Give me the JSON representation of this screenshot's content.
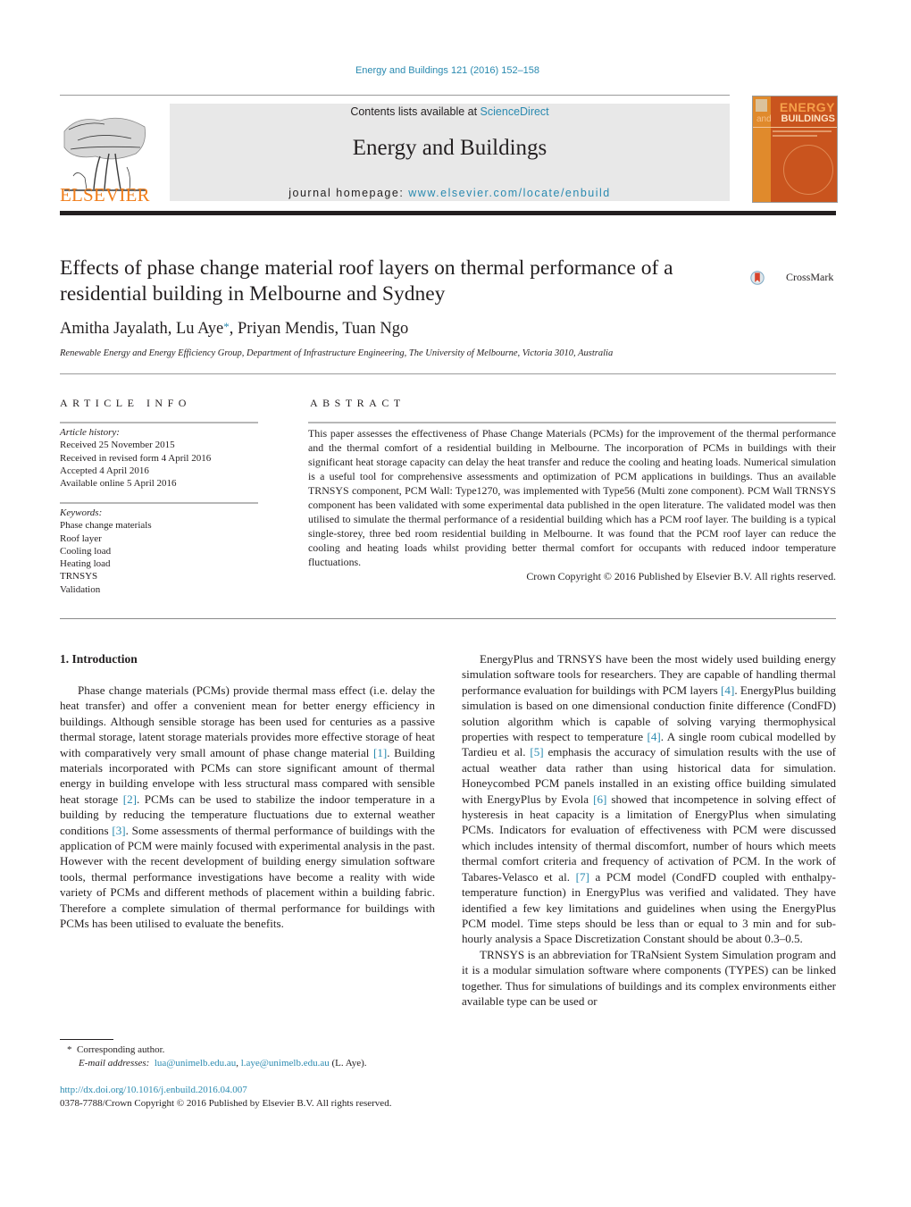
{
  "header": {
    "journal_ref": "Energy and Buildings 121 (2016) 152–158",
    "contents_prefix": "Contents lists available at ",
    "contents_link": "ScienceDirect",
    "journal_title": "Energy and Buildings",
    "homepage_prefix": "journal homepage: ",
    "homepage_link": "www.elsevier.com/locate/enbuild",
    "publisher_logo": "ELSEVIER",
    "cover": {
      "line1": "ENERGY",
      "line2_and": "and",
      "line2": "BUILDINGS"
    },
    "colors": {
      "link": "#2a8ab0",
      "elsevier_orange": "#f07d1a",
      "masthead_bg": "#e8e8e8"
    }
  },
  "article": {
    "title": "Effects of phase change material roof layers on thermal performance of a residential building in Melbourne and Sydney",
    "crossmark_label": "CrossMark",
    "authors_before": "Amitha Jayalath, Lu Aye",
    "authors_star": "*",
    "authors_after": ", Priyan Mendis, Tuan Ngo",
    "affiliation": "Renewable Energy and Energy Efficiency Group, Department of Infrastructure Engineering, The University of Melbourne, Victoria 3010, Australia"
  },
  "article_info": {
    "heading": "ARTICLE INFO",
    "history_label": "Article history:",
    "history": [
      "Received 25 November 2015",
      "Received in revised form 4 April 2016",
      "Accepted 4 April 2016",
      "Available online 5 April 2016"
    ],
    "keywords_label": "Keywords:",
    "keywords": [
      "Phase change materials",
      "Roof layer",
      "Cooling load",
      "Heating load",
      "TRNSYS",
      "Validation"
    ]
  },
  "abstract": {
    "heading": "ABSTRACT",
    "text": "This paper assesses the effectiveness of Phase Change Materials (PCMs) for the improvement of the thermal performance and the thermal comfort of a residential building in Melbourne. The incorporation of PCMs in buildings with their significant heat storage capacity can delay the heat transfer and reduce the cooling and heating loads. Numerical simulation is a useful tool for comprehensive assessments and optimization of PCM applications in buildings. Thus an available TRNSYS component, PCM Wall: Type1270, was implemented with Type56 (Multi zone component). PCM Wall TRNSYS component has been validated with some experimental data published in the open literature. The validated model was then utilised to simulate the thermal performance of a residential building which has a PCM roof layer. The building is a typical single-storey, three bed room residential building in Melbourne. It was found that the PCM roof layer can reduce the cooling and heating loads whilst providing better thermal comfort for occupants with reduced indoor temperature fluctuations.",
    "copyright": "Crown Copyright © 2016 Published by Elsevier B.V. All rights reserved."
  },
  "body": {
    "section_heading": "1.  Introduction",
    "left_para": [
      {
        "t": "Phase change materials (PCMs) provide thermal mass effect (i.e. delay the heat transfer) and offer a convenient mean for better energy efficiency in buildings. Although sensible storage has been used for centuries as a passive thermal storage, latent storage materials provides more effective storage of heat with comparatively very small amount of phase change material "
      },
      {
        "ref": "[1]"
      },
      {
        "t": ". Building materials incorporated with PCMs can store significant amount of thermal energy in building envelope with less structural mass compared with sensible heat storage "
      },
      {
        "ref": "[2]"
      },
      {
        "t": ". PCMs can be used to stabilize the indoor temperature in a building by reducing the temperature fluctuations due to external weather conditions "
      },
      {
        "ref": "[3]"
      },
      {
        "t": ". Some assessments of thermal performance of buildings with the application of PCM were mainly focused with experimental analysis in the past. However with the recent development of building energy simulation software tools, thermal performance investigations have become a reality with wide variety of PCMs and different methods of placement within a building fabric. Therefore a complete simulation of thermal performance for buildings with PCMs has been utilised to evaluate the benefits."
      }
    ],
    "right_para_1": [
      {
        "t": "EnergyPlus and TRNSYS have been the most widely used building energy simulation software tools for researchers. They are capable of handling thermal performance evaluation for buildings with PCM layers "
      },
      {
        "ref": "[4]"
      },
      {
        "t": ". EnergyPlus building simulation is based on one dimensional conduction finite difference (CondFD) solution algorithm which is capable of solving varying thermophysical properties with respect to temperature "
      },
      {
        "ref": "[4]"
      },
      {
        "t": ". A single room cubical modelled by Tardieu et al. "
      },
      {
        "ref": "[5]"
      },
      {
        "t": " emphasis the accuracy of simulation results with the use of actual weather data rather than using historical data for simulation. Honeycombed PCM panels installed in an existing office building simulated with EnergyPlus by Evola "
      },
      {
        "ref": "[6]"
      },
      {
        "t": " showed that incompetence in solving effect of hysteresis in heat capacity is a limitation of EnergyPlus when simulating PCMs. Indicators for evaluation of effectiveness with PCM were discussed which includes intensity of thermal discomfort, number of hours which meets thermal comfort criteria and frequency of activation of PCM. In the work of Tabares-Velasco et al. "
      },
      {
        "ref": "[7]"
      },
      {
        "t": " a PCM model (CondFD coupled with enthalpy-temperature function) in EnergyPlus was verified and validated. They have identified a few key limitations and guidelines when using the EnergyPlus PCM model. Time steps should be less than or equal to 3 min and for sub-hourly analysis a Space Discretization Constant should be about 0.3–0.5."
      }
    ],
    "right_para_2": "TRNSYS is an abbreviation for TRaNsient System Simulation program and it is a modular simulation software where components (TYPES) can be linked together. Thus for simulations of buildings and its complex environments either available type can be used or"
  },
  "footer": {
    "star": "*",
    "corresponding": "Corresponding author.",
    "email_label": "E-mail addresses:",
    "email_1": "lua@unimelb.edu.au",
    "email_sep": ", ",
    "email_2": "l.aye@unimelb.edu.au",
    "email_suffix": " (L. Aye).",
    "doi": "http://dx.doi.org/10.1016/j.enbuild.2016.04.007",
    "issn_copyright": "0378-7788/Crown Copyright © 2016 Published by Elsevier B.V. All rights reserved."
  }
}
